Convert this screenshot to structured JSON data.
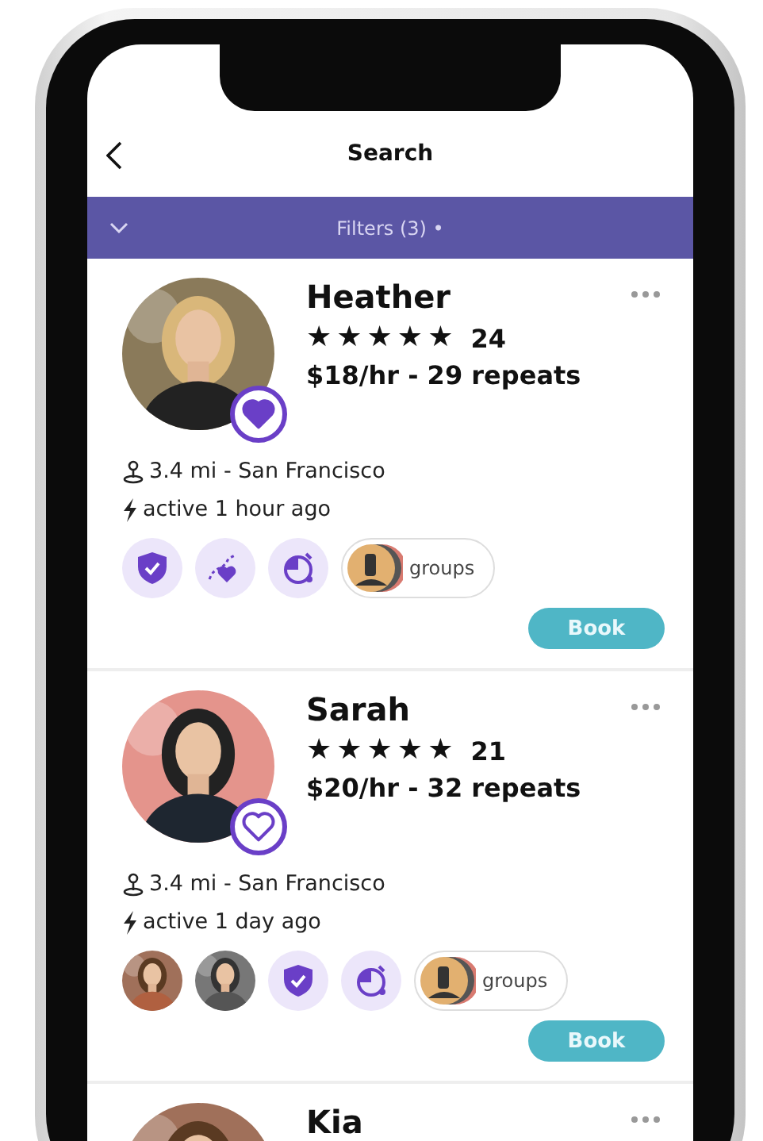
{
  "header": {
    "title": "Search"
  },
  "filter_bar": {
    "label": "Filters (3) •"
  },
  "profiles": [
    {
      "name": "Heather",
      "stars": 5,
      "review_count": "24",
      "rate": "$18/hr - 29 repeats",
      "favorite": true,
      "location": "3.4 mi - San Francisco",
      "active": "active 1 hour ago",
      "badges": [
        {
          "kind": "shield"
        },
        {
          "kind": "route"
        },
        {
          "kind": "timer"
        },
        {
          "kind": "groups",
          "label": "groups"
        }
      ],
      "button": "Book"
    },
    {
      "name": "Sarah",
      "stars": 5,
      "review_count": "21",
      "rate": "$20/hr - 32 repeats",
      "favorite": false,
      "location": "3.4 mi - San Francisco",
      "active": "active 1 day ago",
      "badges": [
        {
          "kind": "avatar"
        },
        {
          "kind": "avatar"
        },
        {
          "kind": "shield"
        },
        {
          "kind": "timer"
        },
        {
          "kind": "groups",
          "label": "groups"
        }
      ],
      "button": "Book"
    },
    {
      "name": "Kia"
    }
  ]
}
